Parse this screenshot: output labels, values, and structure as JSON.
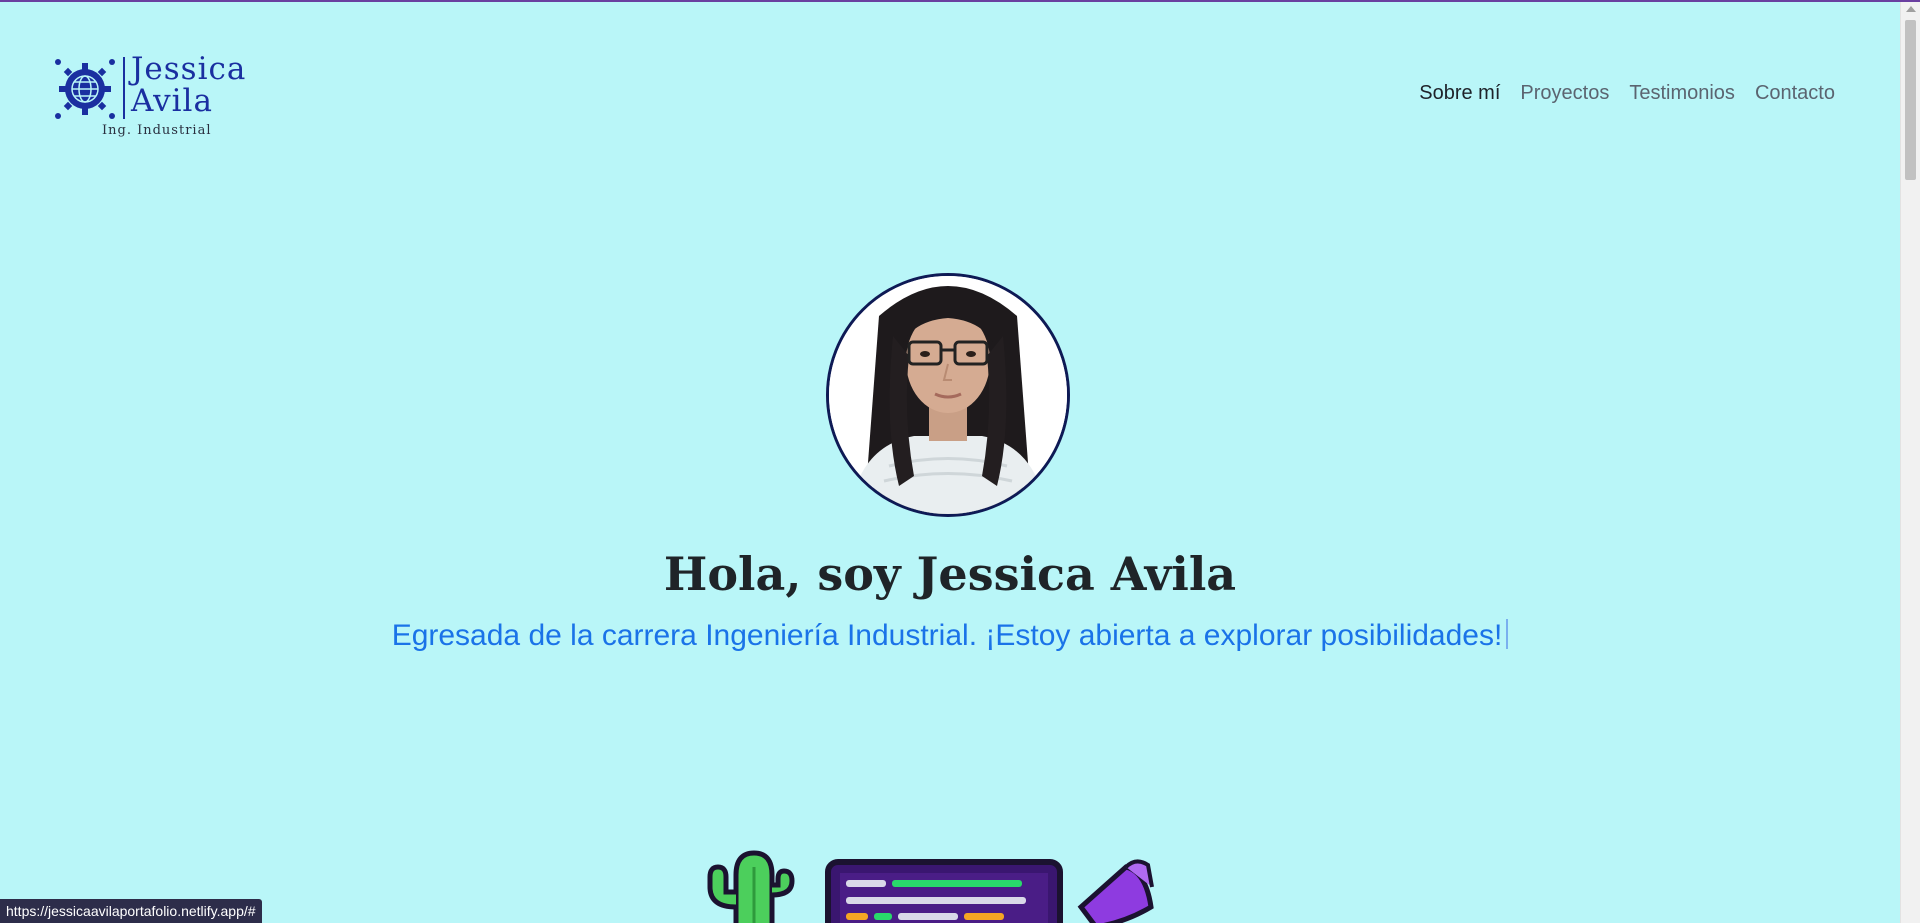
{
  "logo": {
    "name_line1": "Jessica",
    "name_line2": "Avila",
    "subtitle": "Ing. Industrial",
    "icon": "globe-gear-icon"
  },
  "nav": {
    "items": [
      "Sobre mí",
      "Proyectos",
      "Testimonios",
      "Contacto"
    ],
    "active": "Sobre mí"
  },
  "hero": {
    "title": "Hola, soy Jessica Avila",
    "subtitle": "Egresada de la carrera Ingeniería Industrial. ¡Estoy abierta a explorar posibilidades!"
  },
  "status_bar": {
    "url": "https://jessicaavilaportafolio.netlify.app/#"
  },
  "colors": {
    "background": "#b9f6f8",
    "brand_blue": "#1a2fa0",
    "accent_blue": "#1a73e8",
    "avatar_border": "#0e1a55"
  }
}
